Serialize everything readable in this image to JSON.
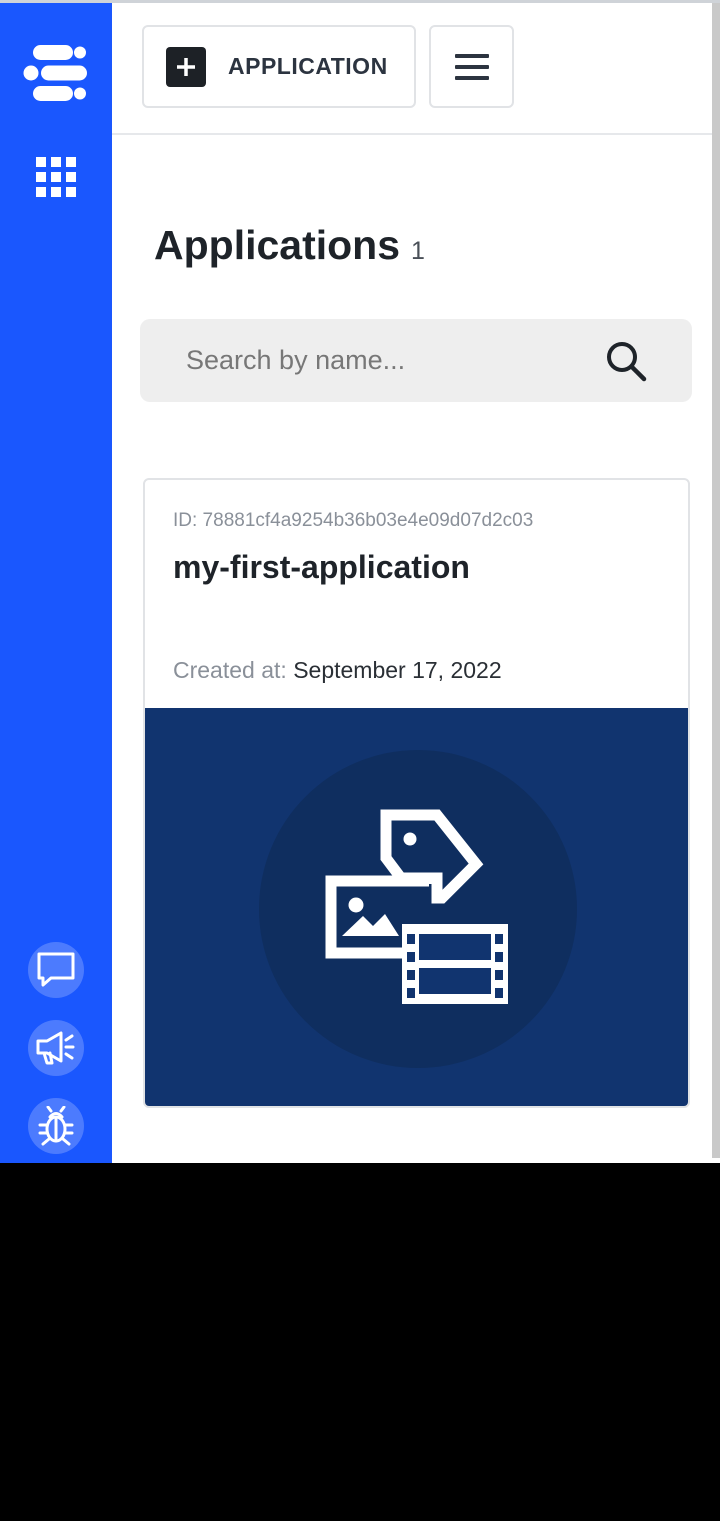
{
  "header": {
    "add_button_label": "APPLICATION"
  },
  "page": {
    "title": "Applications",
    "count": "1"
  },
  "search": {
    "placeholder": "Search by name..."
  },
  "applications": [
    {
      "id_label": "ID: 78881cf4a9254b36b03e4e09d07d2c03",
      "name": "my-first-application",
      "created_label": "Created at:",
      "created_date": "September 17, 2022"
    }
  ],
  "sidebar": {
    "icons": [
      "logo-icon",
      "apps-grid-icon",
      "chat-icon",
      "megaphone-icon",
      "bug-icon"
    ]
  },
  "colors": {
    "sidebar": "#1a57fe",
    "card_media": "#11346f",
    "text_dark": "#1e2329"
  }
}
